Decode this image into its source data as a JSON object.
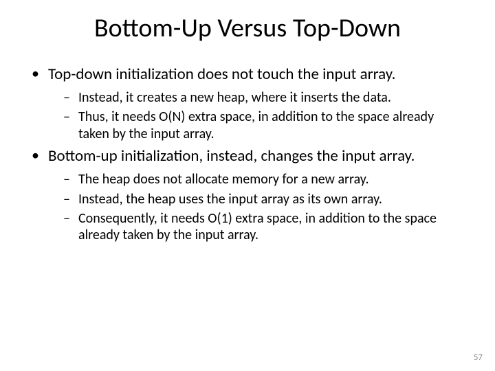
{
  "title": "Bottom-Up Versus Top-Down",
  "bullets": [
    {
      "text": "Top-down initialization does not touch the input array.",
      "sub": [
        "Instead, it creates a new heap, where it inserts the data.",
        "Thus, it needs O(N) extra space, in addition to the space already taken by the input array."
      ]
    },
    {
      "text": "Bottom-up initialization, instead, changes the input array.",
      "sub": [
        "The heap does not allocate memory for a new array.",
        "Instead, the heap uses the input array as its own array.",
        "Consequently, it needs O(1) extra space, in addition to the space already taken by the input array."
      ]
    }
  ],
  "slide_number": "57"
}
